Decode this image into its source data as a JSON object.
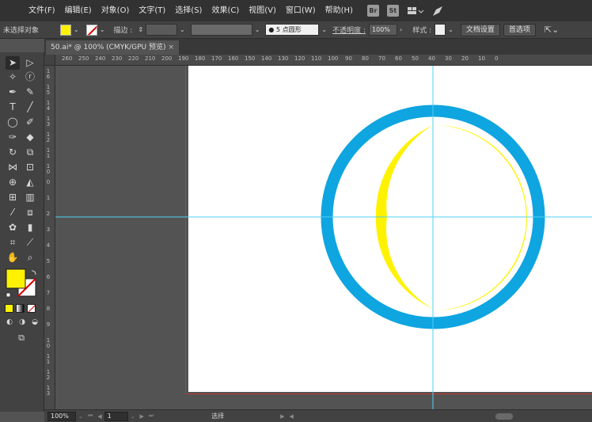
{
  "menubar": {
    "items": [
      "文件(F)",
      "编辑(E)",
      "对象(O)",
      "文字(T)",
      "选择(S)",
      "效果(C)",
      "视图(V)",
      "窗口(W)",
      "帮助(H)"
    ],
    "bridge_label": "Br",
    "stock_label": "St"
  },
  "controlbar": {
    "no_selection": "未选择对象",
    "stroke_label": "描边 :",
    "brush_value": "5 点圆形",
    "opacity_label": "不透明度 :",
    "opacity_value": "100%",
    "style_label": "样式 :",
    "doc_setup": "文档设置",
    "preferences": "首选项"
  },
  "document": {
    "tab_title": "50.ai* @ 100% (CMYK/GPU 预览)",
    "close_glyph": "×"
  },
  "ruler": {
    "h_labels": [
      "260",
      "250",
      "240",
      "230",
      "220",
      "210",
      "200",
      "190",
      "180",
      "170",
      "160",
      "150",
      "140",
      "130",
      "120",
      "110",
      "100",
      "90",
      "80",
      "70",
      "60",
      "50",
      "40",
      "30",
      "20",
      "10",
      "0"
    ],
    "v_labels": [
      "1 6",
      "1 5",
      "1 4",
      "1 3",
      "1 2",
      "1 1",
      "1 0",
      "0",
      "1",
      "2",
      "3",
      "4",
      "5",
      "6",
      "7",
      "8",
      "9",
      "1 0",
      "1 1",
      "1 2",
      "1 3"
    ]
  },
  "status": {
    "zoom": "100%",
    "page": "1",
    "mode": "选择"
  },
  "colors": {
    "fill": "#fff200",
    "outer_ring": "#0ea5e0",
    "inner_ring": "#fff200",
    "guide": "#4fd0f5",
    "bleed": "#c0392b"
  }
}
